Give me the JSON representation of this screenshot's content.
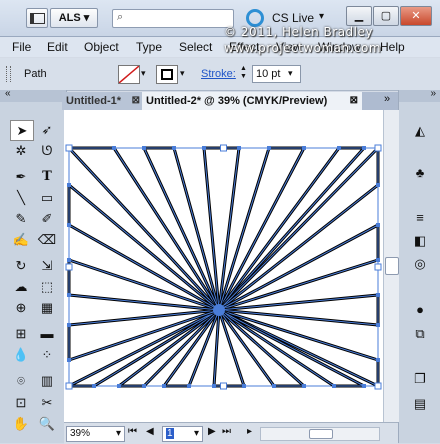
{
  "app": {
    "logo": "Ai",
    "workspace_label": "ALS",
    "search_placeholder": "",
    "cslive_label": "CS Live"
  },
  "watermark": {
    "line1": "© 2011, Helen Bradley",
    "line2": "www.projectwoman.com"
  },
  "menu": [
    "File",
    "Edit",
    "Object",
    "Type",
    "Select",
    "Effect",
    "View",
    "Window",
    "Help"
  ],
  "control_bar": {
    "selection_label": "Path",
    "stroke_label": "Stroke:",
    "stroke_value": "10 pt"
  },
  "tabs": [
    {
      "label": "Untitled-1*",
      "active": false
    },
    {
      "label": "Untitled-2* @ 39% (CMYK/Preview)",
      "active": true
    }
  ],
  "status": {
    "zoom": "39%",
    "page": "1"
  },
  "colors": {
    "accent": "#2d8fd4",
    "selection": "#4a7dd8",
    "stroke": "#000000"
  }
}
